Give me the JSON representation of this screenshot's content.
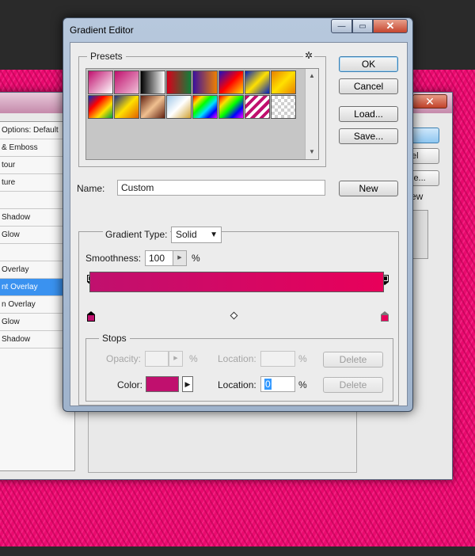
{
  "layer_style": {
    "close_glyph": "✕",
    "items": [
      {
        "label": "Options: Default",
        "selected": false
      },
      {
        "label": "& Emboss",
        "selected": false
      },
      {
        "label": "tour",
        "selected": false
      },
      {
        "label": "ture",
        "selected": false
      },
      {
        "label": "",
        "selected": false
      },
      {
        "label": "Shadow",
        "selected": false
      },
      {
        "label": "Glow",
        "selected": false
      },
      {
        "label": "",
        "selected": false
      },
      {
        "label": "Overlay",
        "selected": false
      },
      {
        "label": "nt Overlay",
        "selected": true
      },
      {
        "label": "n Overlay",
        "selected": false
      },
      {
        "label": "Glow",
        "selected": false
      },
      {
        "label": "Shadow",
        "selected": false
      }
    ],
    "right_buttons": [
      "",
      "el",
      "le...",
      "ew"
    ]
  },
  "dialog": {
    "title": "Gradient Editor",
    "window_buttons": {
      "minimize": "—",
      "maximize": "▭",
      "close": "✕"
    },
    "presets": {
      "label": "Presets",
      "gear_icon": "gear-icon",
      "gear_glyph": "✲",
      "swatches": [
        "linear-gradient(135deg,#c0106e,#ffffff)",
        "linear-gradient(135deg,#c0106e,#f0c0d8)",
        "linear-gradient(90deg,#000000,#ffffff)",
        "linear-gradient(90deg,#d8001a,#10803a)",
        "linear-gradient(90deg,#3a10a0,#f08000)",
        "linear-gradient(135deg,#2010c0,#ff0000,#ffe000)",
        "linear-gradient(135deg,#0020c0,#ffe000,#0020c0)",
        "linear-gradient(135deg,#e88000,#ffe000,#e88000)",
        "linear-gradient(135deg,#0030c0,#ff0000,#ffe000,#00a040)",
        "linear-gradient(135deg,#203080,#ffe000,#e06000)",
        "linear-gradient(135deg,#602010,#f0c090,#602010)",
        "linear-gradient(135deg,#a0c8e8,#ffffff,#d0a030)",
        "linear-gradient(135deg,#ff0000,#ffe000,#00ff00,#00e0ff,#0000ff,#ff00ff)",
        "linear-gradient(135deg,#ff0000,#ffe000,#00ff00,#0000ff,#ff00ff)",
        "repeating-linear-gradient(135deg,#c0106e 0 4px,#ffffff 4px 8px)",
        "repeating-conic-gradient(#cfcfcf 0 25%,#ffffff 0 50%) 0 0/8px 8px"
      ]
    },
    "buttons": {
      "ok": "OK",
      "cancel": "Cancel",
      "load": "Load...",
      "save": "Save...",
      "new": "New"
    },
    "name": {
      "label": "Name:",
      "value": "Custom"
    },
    "gradient": {
      "type_label": "Gradient Type:",
      "type_value": "Solid",
      "smoothness_label": "Smoothness:",
      "smoothness_value": "100",
      "smoothness_unit": "%",
      "start_color": "#c0106e",
      "end_color": "#e8005a"
    },
    "stops": {
      "label": "Stops",
      "opacity_label": "Opacity:",
      "opacity_value": "",
      "opacity_unit": "%",
      "opacity_location_label": "Location:",
      "opacity_location_value": "",
      "opacity_location_unit": "%",
      "opacity_delete": "Delete",
      "color_label": "Color:",
      "color_value": "#c0106e",
      "color_location_label": "Location:",
      "color_location_value": "0",
      "color_location_unit": "%",
      "color_delete": "Delete"
    }
  }
}
